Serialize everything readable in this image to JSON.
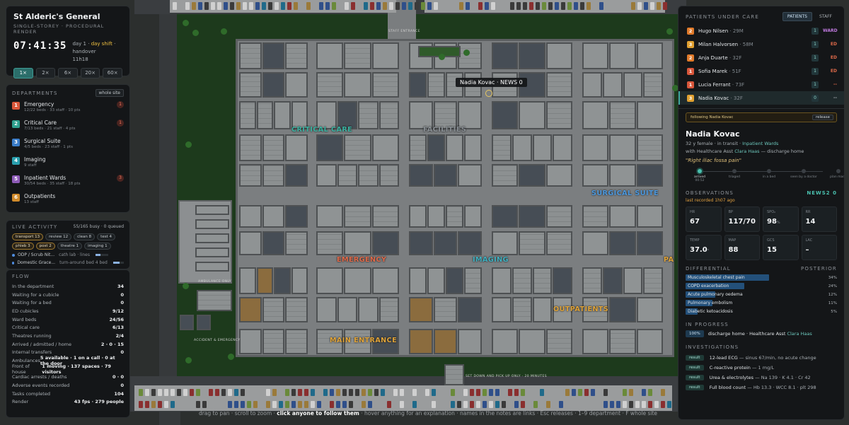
{
  "hospital": {
    "name": "St Alderic's General",
    "subtitle": "SINGLE-STOREY · PROCEDURAL RENDER",
    "clock": "07:41:35",
    "day": "day 1 ·",
    "shift": "day shift",
    "handover": "· handover",
    "handover_time": "11h18"
  },
  "speeds": [
    "1×",
    "2×",
    "6×",
    "20×",
    "60×"
  ],
  "departments": {
    "title": "DEPARTMENTS",
    "whole_site": "whole site",
    "items": [
      {
        "num": "1",
        "name": "Emergency",
        "stats": "12/22 beds · 33 staff · 10 pts",
        "alert": "1",
        "color": "#d9563a"
      },
      {
        "num": "2",
        "name": "Critical Care",
        "stats": "7/13 beds · 21 staff · 4 pts",
        "alert": "1",
        "color": "#2fa08f"
      },
      {
        "num": "3",
        "name": "Surgical Suite",
        "stats": "4/5 beds · 23 staff · 1 pts",
        "alert": "",
        "color": "#3a7cc8"
      },
      {
        "num": "4",
        "name": "Imaging",
        "stats": "9 staff",
        "alert": "",
        "color": "#2a9fae"
      },
      {
        "num": "5",
        "name": "Inpatient Wards",
        "stats": "30/54 beds · 35 staff · 18 pts",
        "alert": "3",
        "color": "#8e5bb8"
      },
      {
        "num": "6",
        "name": "Outpatients",
        "stats": "13 staff",
        "alert": "",
        "color": "#d08a2a"
      }
    ]
  },
  "live": {
    "title": "LIVE ACTIVITY",
    "busy": "55/165 busy · 0 queued",
    "chips": [
      "transport 13",
      "review 12",
      "clean 8",
      "test 4",
      "phleb 3",
      "post 2",
      "theatre 1",
      "imaging 1"
    ],
    "tasks": [
      {
        "who": "ODP / Scrub Nit...",
        "where": "cath lab · lines",
        "progress": 0.4
      },
      {
        "who": "Domestic Grace...",
        "where": "turn-around bed 4 bed",
        "progress": 0.6
      }
    ]
  },
  "flow": {
    "title": "FLOW",
    "rows": [
      {
        "k": "In the department",
        "v": "34"
      },
      {
        "k": "Waiting for a cubicle",
        "v": "0"
      },
      {
        "k": "Waiting for a bed",
        "v": "0"
      },
      {
        "k": "ED cubicles",
        "v": "9/12"
      },
      {
        "k": "Ward beds",
        "v": "24/56"
      },
      {
        "k": "Critical care",
        "v": "6/13"
      },
      {
        "k": "Theatres running",
        "v": "2/4"
      },
      {
        "k": "Arrived / admitted / home",
        "v": "2 · 0 · 15"
      },
      {
        "k": "Internal transfers",
        "v": "0"
      },
      {
        "k": "Ambulances",
        "v": "5 available · 1 on a call · 0 at the door"
      },
      {
        "k": "Front of house",
        "v": "1 moving · 137 spaces · 79 visitors"
      },
      {
        "k": "Cardiac arrests / deaths",
        "v": "0 · 0"
      },
      {
        "k": "Adverse events recorded",
        "v": "0"
      },
      {
        "k": "Tasks completed",
        "v": "104"
      },
      {
        "k": "Render",
        "v": "43 fps · 279 people"
      }
    ]
  },
  "map": {
    "zones": [
      {
        "label": "CRITICAL CARE",
        "color": "#3bb3a2"
      },
      {
        "label": "FACILITIES",
        "color": "#8a9095"
      },
      {
        "label": "SURGICAL SUITE",
        "color": "#4d9ae0"
      },
      {
        "label": "EMERGENCY",
        "color": "#e06a4a"
      },
      {
        "label": "IMAGING",
        "color": "#3fb0c0"
      },
      {
        "label": "OUTPATIENTS",
        "color": "#e0a43a"
      },
      {
        "label": "MAIN ENTRANCE",
        "color": "#e0a43a"
      },
      {
        "label": "PA",
        "color": "#e0a43a"
      }
    ],
    "small_labels": [
      "STAFF ENTRANCE",
      "AMBULANCE ONLY",
      "ACCIDENT & EMERGENCY",
      "SET DOWN AND PICK UP ONLY · 20 MINUTES"
    ],
    "tooltip": "Nadia Kovac · NEWS 0",
    "hint_pre": "drag to pan · scroll to zoom ·",
    "hint_bold": "click anyone to follow them",
    "hint_post": "· hover anything for an explanation · names in the notes are links · Esc releases · 1–9 department · F whole site"
  },
  "right": {
    "title": "PATIENTS UNDER CARE",
    "tab_patients": "PATIENTS",
    "tab_staff": "STAFF",
    "patients": [
      {
        "num": "2",
        "name": "Hugo Nilsen",
        "age": "· 29M",
        "count": "1",
        "loc": "WARD",
        "color": "#e07a2a",
        "loc_color": "#c07ae0"
      },
      {
        "num": "3",
        "name": "Milan Halvorsen",
        "age": "· 58M",
        "count": "1",
        "loc": "ED",
        "color": "#e0a030",
        "loc_color": "#e06a4a"
      },
      {
        "num": "2",
        "name": "Anja Duarte",
        "age": "· 32F",
        "count": "1",
        "loc": "ED",
        "color": "#e07a2a",
        "loc_color": "#e06a4a"
      },
      {
        "num": "1",
        "name": "Sofia Marek",
        "age": "· 51F",
        "count": "1",
        "loc": "ED",
        "color": "#d9563a",
        "loc_color": "#e06a4a"
      },
      {
        "num": "1",
        "name": "Lucia Ferrant",
        "age": "· 73F",
        "count": "1",
        "loc": "--",
        "color": "#d9563a",
        "loc_color": "#e06a4a"
      },
      {
        "num": "3",
        "name": "Nadia Kovac",
        "age": "· 32F",
        "count": "0",
        "loc": "--",
        "color": "#e0a030",
        "loc_color": "#aab0b5"
      }
    ],
    "following": "following Nadia Kovac",
    "release": "release",
    "patient_name": "Nadia Kovac",
    "line1_pre": "32 y female · in transit ·",
    "line1_hl": "Inpatient Wards",
    "line2_pre": "with Healthcare Asst",
    "line2_hl": "Clara Haas",
    "line2_post": "— discharge home",
    "complaint": "\"Right iliac fossa pain\"",
    "timeline": [
      {
        "label": "arrived",
        "time": "00:52",
        "done": true
      },
      {
        "label": "triaged",
        "time": "",
        "done": false
      },
      {
        "label": "in a bed",
        "time": "",
        "done": false
      },
      {
        "label": "seen by a doctor",
        "time": "",
        "done": false
      },
      {
        "label": "plan made",
        "time": "",
        "done": false
      }
    ],
    "obs_title": "OBSERVATIONS",
    "news": "NEWS2 0",
    "last_recorded": "last recorded 1h07 ago",
    "vitals": [
      {
        "k": "HR",
        "v": "67",
        "u": ""
      },
      {
        "k": "BP",
        "v": "117/70",
        "u": ""
      },
      {
        "k": "SPO₂",
        "v": "98",
        "u": "%"
      },
      {
        "k": "RR",
        "v": "14",
        "u": ""
      },
      {
        "k": "TEMP",
        "v": "37.0",
        "u": "°"
      },
      {
        "k": "MAP",
        "v": "88",
        "u": ""
      },
      {
        "k": "GCS",
        "v": "15",
        "u": ""
      },
      {
        "k": "LAC",
        "v": "–",
        "u": ""
      }
    ],
    "diff_title": "DIFFERENTIAL",
    "posterior": "POSTERIOR",
    "differential": [
      {
        "name": "Musculoskeletal chest pain",
        "pct": "34%",
        "p": 0.34
      },
      {
        "name": "COPD exacerbation",
        "pct": "24%",
        "p": 0.24
      },
      {
        "name": "Acute pulmonary oedema",
        "pct": "12%",
        "p": 0.12
      },
      {
        "name": "Pulmonary embolism",
        "pct": "11%",
        "p": 0.11
      },
      {
        "name": "Diabetic ketoacidosis",
        "pct": "5%",
        "p": 0.05
      }
    ],
    "in_progress_title": "IN PROGRESS",
    "in_progress": {
      "badge": "100%",
      "pre": "discharge home · Healthcare Asst",
      "hl": "Clara Haas"
    },
    "inv_title": "INVESTIGATIONS",
    "investigations": [
      {
        "badge": "result",
        "name": "12-lead ECG",
        "res": "— sinus 67/min, no acute change"
      },
      {
        "badge": "result",
        "name": "C-reactive protein",
        "res": "— 1 mg/L"
      },
      {
        "badge": "result",
        "name": "Urea & electrolytes",
        "res": "— Na 139 · K 4.1 · Cr 42"
      },
      {
        "badge": "result",
        "name": "Full blood count",
        "res": "— Hb 13.3 · WCC 8.1 · plt 298"
      }
    ]
  }
}
